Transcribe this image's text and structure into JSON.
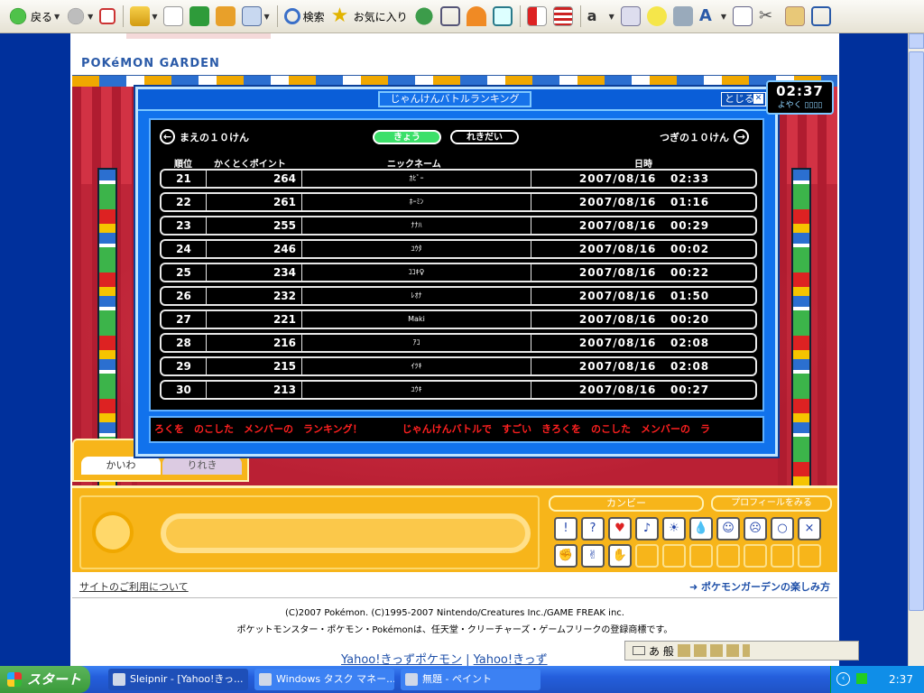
{
  "toolbar": {
    "back": "戻る",
    "search": "検索",
    "favorites": "お気に入り"
  },
  "site": {
    "title": "POKéMON GARDEN"
  },
  "dialog": {
    "title": "じゃんけんバトルランキング",
    "close": "とじる",
    "prev": "まえの１０けん",
    "next": "つぎの１０けん",
    "tab_today": "きょう",
    "tab_history": "れきだい",
    "headers": {
      "rank": "順位",
      "points": "かくとくポイント",
      "nickname": "ニックネーム",
      "datetime": "日時"
    },
    "rows": [
      {
        "rank": "21",
        "points": "264",
        "name": "ｶﾋﾞｰ",
        "date": "2007/08/16",
        "time": "02:33"
      },
      {
        "rank": "22",
        "points": "261",
        "name": "ﾎｰﾐﾝ",
        "date": "2007/08/16",
        "time": "01:16"
      },
      {
        "rank": "23",
        "points": "255",
        "name": "ﾅﾅﾊ",
        "date": "2007/08/16",
        "time": "00:29"
      },
      {
        "rank": "24",
        "points": "246",
        "name": "ﾕｳﾀ",
        "date": "2007/08/16",
        "time": "00:02"
      },
      {
        "rank": "25",
        "points": "234",
        "name": "ｺｺｷ♀",
        "date": "2007/08/16",
        "time": "00:22"
      },
      {
        "rank": "26",
        "points": "232",
        "name": "ﾚｵﾅ",
        "date": "2007/08/16",
        "time": "01:50"
      },
      {
        "rank": "27",
        "points": "221",
        "name": "Maki",
        "date": "2007/08/16",
        "time": "00:20"
      },
      {
        "rank": "28",
        "points": "216",
        "name": "ｱｺ",
        "date": "2007/08/16",
        "time": "02:08"
      },
      {
        "rank": "29",
        "points": "215",
        "name": "ｲﾂｷ",
        "date": "2007/08/16",
        "time": "02:08"
      },
      {
        "rank": "30",
        "points": "213",
        "name": "ﾕｳｷ",
        "date": "2007/08/16",
        "time": "00:27"
      }
    ],
    "ticker": "ろくを　のこした　メンバーの　ランキング！　　　　じゃんけんバトルで　すごい　きろくを　のこした　メンバーの　ラ"
  },
  "clock": {
    "time": "02:37",
    "label": "よやく"
  },
  "chat": {
    "tab_talk": "かいわ",
    "tab_history": "りれき"
  },
  "profile": {
    "name": "カンビー",
    "button": "プロフィールをみる"
  },
  "footer": {
    "usage": "サイトのご利用について",
    "enjoy": "ポケモンガーデンの楽しみ方",
    "copyright": "(C)2007 Pokémon. (C)1995-2007 Nintendo/Creatures Inc./GAME FREAK inc.",
    "trademark": "ポケットモンスター・ポケモン・Pokémonは、任天堂・クリーチャーズ・ゲームフリークの登録商標です。",
    "yahoo_pokemon": "Yahoo!きっずポケモン",
    "yahoo_kids": "Yahoo!きっず"
  },
  "ime": {
    "mode": "あ 般"
  },
  "taskbar": {
    "start": "スタート",
    "tasks": [
      "Sleipnir - [Yahoo!きっ...",
      "Windows タスク マネー...",
      "無題 - ペイント"
    ],
    "time": "2:37"
  },
  "colors": {
    "dialog_blue": "#1172ec",
    "ticker_red": "#ff2020",
    "tab_active": "#3ce06a",
    "panel_orange": "#f7b51a",
    "curtain_red": "#c8263a",
    "taskbar_blue": "#245edc"
  }
}
